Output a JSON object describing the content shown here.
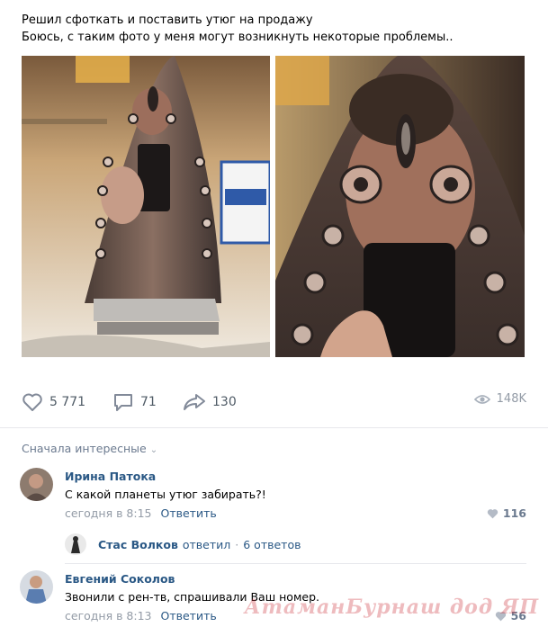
{
  "post": {
    "text_line1": "Решил сфоткать и поставить утюг на продажу",
    "text_line2": "Боюсь, с таким фото у меня могут возникнуть некоторые проблемы.."
  },
  "actions": {
    "likes": "5 771",
    "comments": "71",
    "shares": "130",
    "views": "148K"
  },
  "comments_section": {
    "sort_label": "Сначала интересные"
  },
  "comments": [
    {
      "author": "Ирина Патока",
      "text": "С какой планеты утюг забирать?!",
      "time": "сегодня в 8:15",
      "reply_label": "Ответить",
      "likes": "116"
    },
    {
      "author": "Евгений Соколов",
      "text": "Звонили с рен-тв, спрашивали Ваш номер.",
      "time": "сегодня в 8:13",
      "reply_label": "Ответить",
      "likes": "56"
    }
  ],
  "thread": {
    "author": "Стас Волков",
    "action": "ответил",
    "replies": "6 ответов"
  },
  "watermark": "АтаманБурнаш дод ЯП",
  "colors": {
    "link": "#2a5885",
    "meta": "#939ba6",
    "icon": "#828a99"
  }
}
